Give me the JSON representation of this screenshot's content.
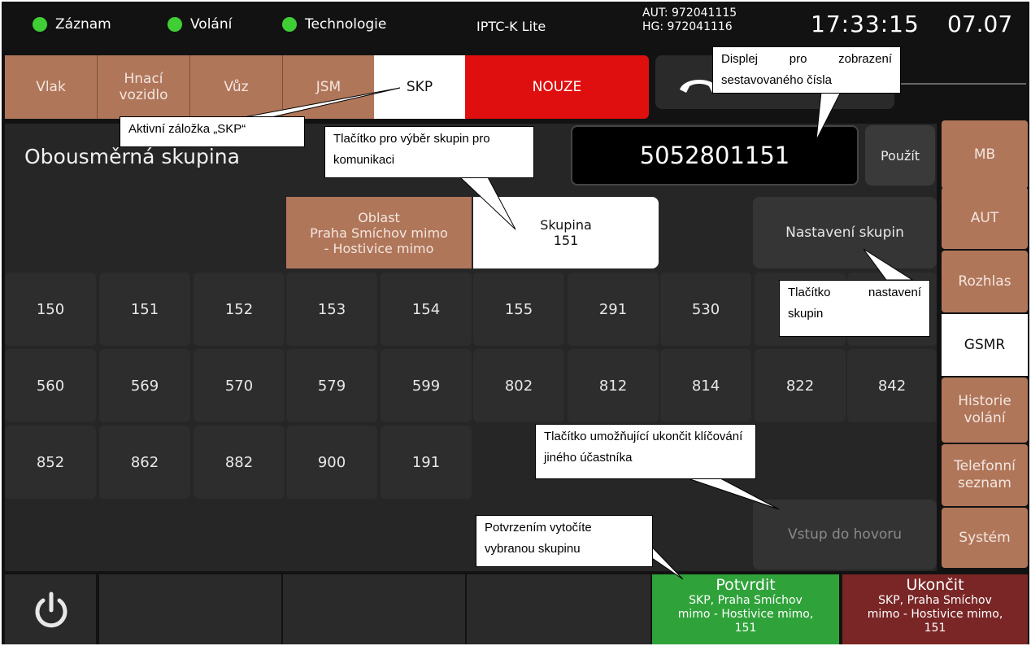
{
  "status": {
    "items": [
      {
        "label": "Záznam",
        "color": "#3fcf35"
      },
      {
        "label": "Volání",
        "color": "#3fcf35"
      },
      {
        "label": "Technologie",
        "color": "#3fcf35"
      }
    ],
    "title": "IPTC-K Lite",
    "aut": "AUT: 972041115",
    "hg": "HG: 972041116",
    "time": "17:33:15",
    "date": "07.07"
  },
  "tabs": {
    "vlak": "Vlak",
    "hnaci": "Hnací\nvozidlo",
    "vuz": "Vůz",
    "jsm": "JSM",
    "skp": "SKP",
    "nouze": "NOUZE"
  },
  "main": {
    "title": "Obousměrná skupina",
    "display_number": "5052801151",
    "use_button": "Použít",
    "area_button": "Oblast\nPraha Smíchov mimo\n- Hostivice mimo",
    "group_button": "Skupina\n151",
    "settings_button": "Nastavení skupin",
    "join_call_button": "Vstup do hovoru",
    "keys": [
      "150",
      "151",
      "152",
      "153",
      "154",
      "155",
      "291",
      "530",
      "",
      "",
      "560",
      "569",
      "570",
      "579",
      "599",
      "802",
      "812",
      "814",
      "822",
      "842",
      "852",
      "862",
      "882",
      "900",
      "191"
    ]
  },
  "sidebar": [
    "MB",
    "AUT",
    "Rozhlas",
    "GSMR",
    "Historie\nvolání",
    "Telefonní\nseznam",
    "Systém"
  ],
  "bottom": {
    "confirm_title": "Potvrdit",
    "confirm_detail": "SKP, Praha Smíchov\nmimo - Hostivice mimo,\n151",
    "end_title": "Ukončit",
    "end_detail": "SKP, Praha Smíchov\nmimo - Hostivice mimo,\n151",
    "power_icon": "power-icon"
  },
  "callouts": {
    "display": "Displej pro zobrazení sestavovaného čísla",
    "active_tab": "Aktivní záložka „SKP“",
    "group_select": "Tlačítko pro výběr skupin pro komunikaci",
    "settings": "Tlačítko nastavení skupin",
    "end_keying": "Tlačítko umožňující ukončit klíčování jiného účastníka",
    "confirm": "Potvrzením vytočíte vybranou skupinu"
  },
  "colors": {
    "status_green": "#3fcf35",
    "tab_brown": "#b0765a",
    "emergency_red": "#e00f0f",
    "confirm_green": "#2fa33a",
    "end_red": "#7a2626"
  }
}
